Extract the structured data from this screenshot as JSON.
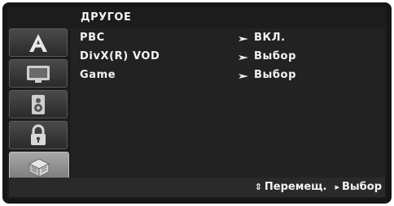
{
  "menu": {
    "title": "ДРУГОЕ"
  },
  "tabs": [
    {
      "icon": "language-a-icon",
      "active": false
    },
    {
      "icon": "display-tv-icon",
      "active": false
    },
    {
      "icon": "speaker-audio-icon",
      "active": false
    },
    {
      "icon": "lock-icon",
      "active": false
    },
    {
      "icon": "others-menu-icon",
      "active": true
    }
  ],
  "rows": [
    {
      "label": "PBC",
      "value": "ВКЛ."
    },
    {
      "label": "DivX(R) VOD",
      "value": "Выбор"
    },
    {
      "label": "Game",
      "value": "Выбор"
    }
  ],
  "footer": {
    "move_symbol": "⇕",
    "move_label": "Перемещ.",
    "select_symbol": "▸",
    "select_label": "Выбор"
  },
  "colors": {
    "background": "#1c1c1c",
    "active_tab": "#9a9a9a",
    "text": "#f4f4f4"
  }
}
